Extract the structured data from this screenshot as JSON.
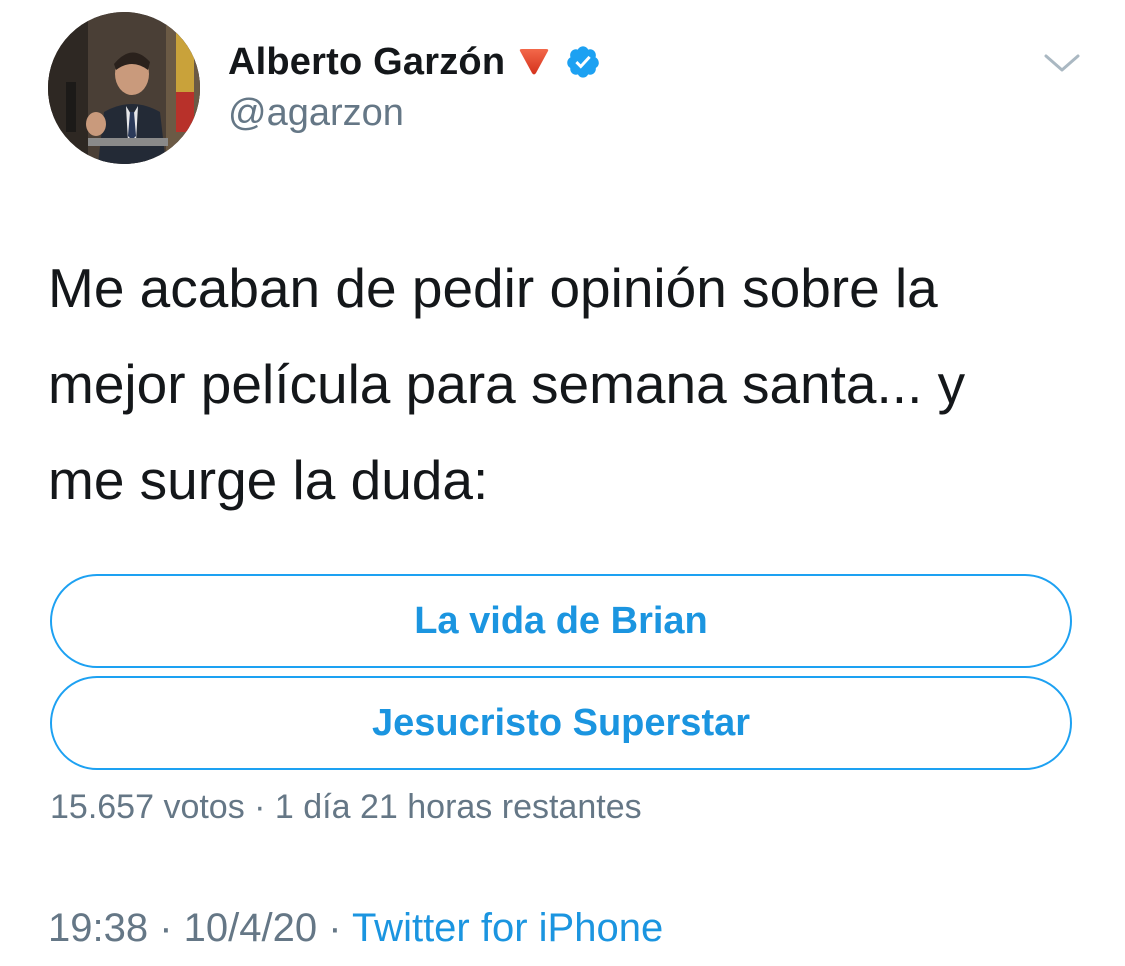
{
  "author": {
    "display_name": "Alberto Garzón",
    "handle": "@agarzon",
    "avatar": "avatar-photo",
    "flag_icon": "red-down-triangle-icon",
    "verified_icon": "verified-badge-icon"
  },
  "menu": {
    "icon": "chevron-down-icon"
  },
  "tweet": {
    "text": "Me acaban de pedir opinión sobre la\nmejor película para semana santa... y\nme surge la duda:"
  },
  "poll": {
    "options": [
      {
        "label": "La vida de Brian"
      },
      {
        "label": "Jesucristo Superstar"
      }
    ],
    "meta": "15.657 votos · 1 día 21 horas restantes"
  },
  "footer": {
    "time": "19:38",
    "date": "10/4/20",
    "separator": " · ",
    "source": "Twitter for iPhone"
  },
  "colors": {
    "accent": "#1b95e0",
    "border": "#1da1f2",
    "secondary_text": "#657786",
    "primary_text": "#14171a",
    "flag_red": "#e0442a",
    "verified_blue": "#1da1f2"
  }
}
